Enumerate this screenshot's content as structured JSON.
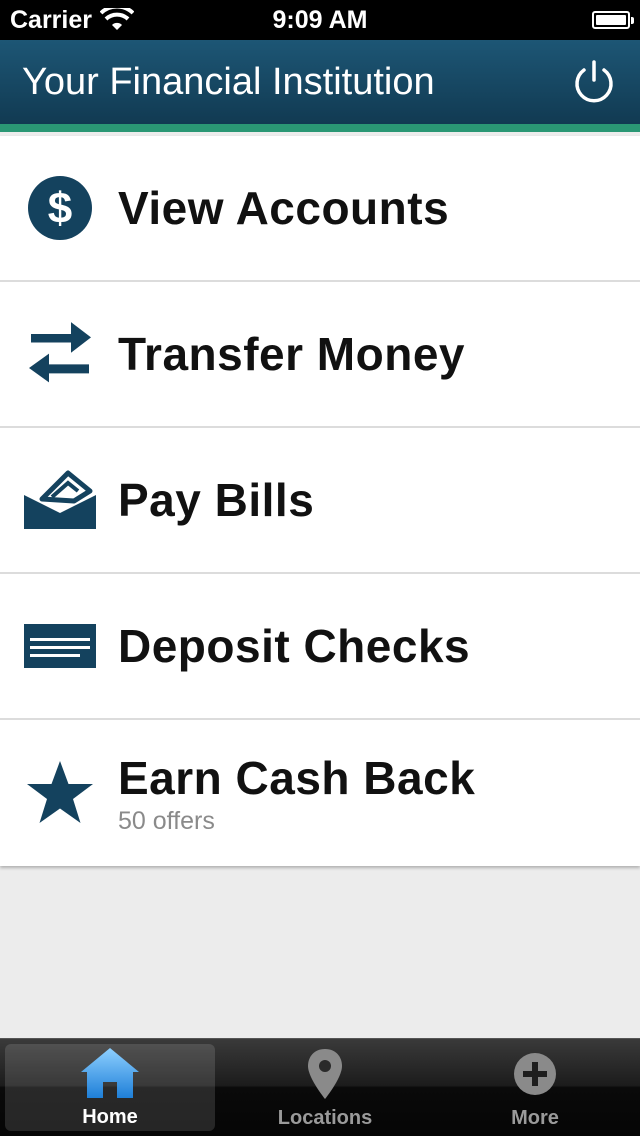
{
  "status_bar": {
    "carrier": "Carrier",
    "time": "9:09 AM",
    "icons": [
      "wifi-icon",
      "battery-icon"
    ]
  },
  "header": {
    "title": "Your Financial Institution",
    "power_icon": "power-icon"
  },
  "menu": {
    "items": [
      {
        "label": "View Accounts",
        "icon": "dollar-icon"
      },
      {
        "label": "Transfer Money",
        "icon": "transfer-arrows-icon"
      },
      {
        "label": "Pay Bills",
        "icon": "bill-payment-icon"
      },
      {
        "label": "Deposit Checks",
        "icon": "check-icon"
      },
      {
        "label": "Earn Cash Back",
        "sublabel": "50 offers",
        "icon": "star-icon"
      }
    ]
  },
  "tab_bar": {
    "tabs": [
      {
        "label": "Home",
        "icon": "home-icon",
        "active": true
      },
      {
        "label": "Locations",
        "icon": "location-pin-icon",
        "active": false
      },
      {
        "label": "More",
        "icon": "plus-icon",
        "active": false
      }
    ]
  },
  "colors": {
    "header_dark": "#113a52",
    "header_accent": "#2a9774",
    "icon_navy": "#14425e",
    "tab_active_blue": "#3aa0e8"
  }
}
